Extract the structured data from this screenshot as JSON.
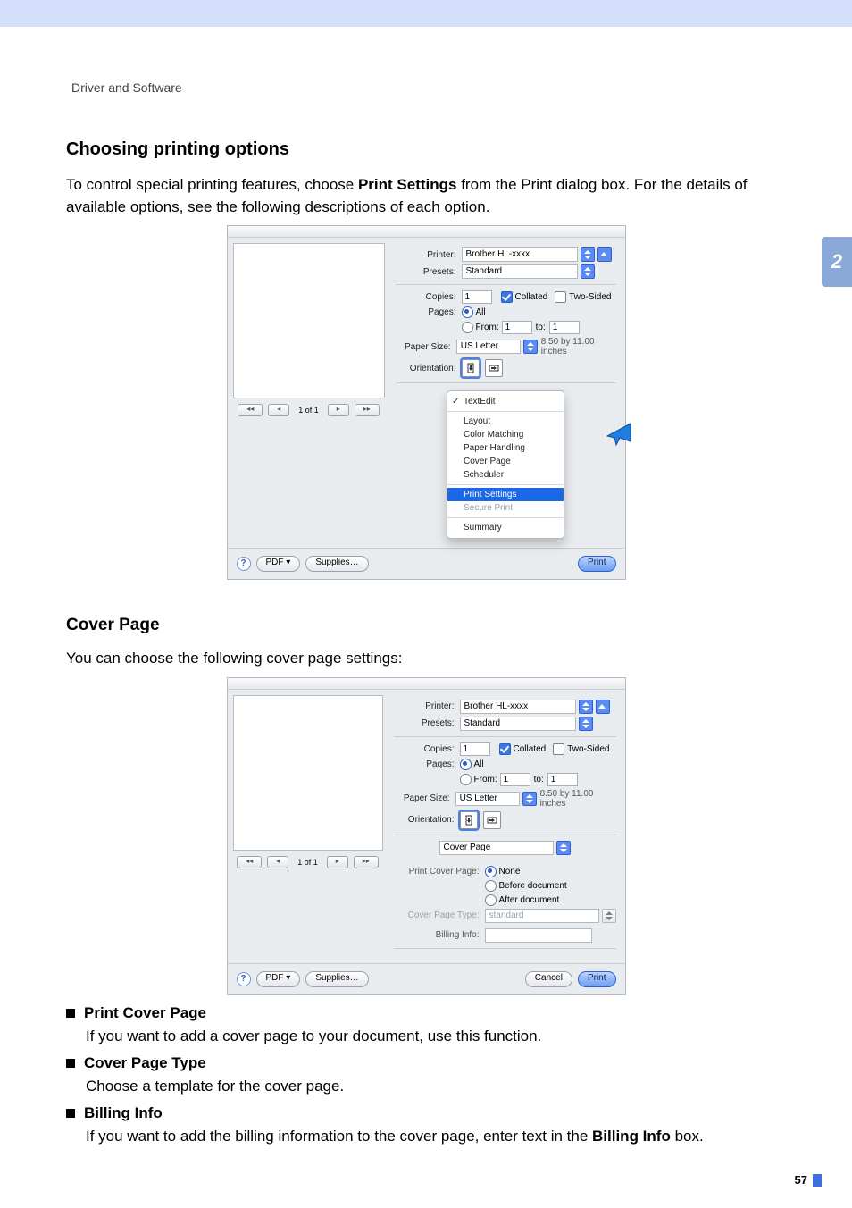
{
  "running_head": "Driver and Software",
  "chapter_tab": "2",
  "page_number": "57",
  "sec1": {
    "h": "Choosing printing options",
    "p_a": "To control special printing features, choose ",
    "p_b": "Print Settings",
    "p_c": " from the Print dialog box. For the details of available options, see the following descriptions of each option."
  },
  "sec2": {
    "h": "Cover Page",
    "p": "You can choose the following cover page settings:"
  },
  "items": {
    "a": {
      "t": "Print Cover Page",
      "d": "If you want to add a cover page to your document, use this function."
    },
    "b": {
      "t": "Cover Page Type",
      "d": "Choose a template for the cover page."
    },
    "c": {
      "t": "Billing Info",
      "d_a": "If you want to add the billing information to the cover page, enter text in the ",
      "d_b": "Billing Info",
      "d_c": " box."
    }
  },
  "dlg": {
    "printer_l": "Printer:",
    "printer_v": "Brother HL-xxxx",
    "presets_l": "Presets:",
    "presets_v": "Standard",
    "copies_l": "Copies:",
    "copies_v": "1",
    "collated": "Collated",
    "twosided": "Two-Sided",
    "pages_l": "Pages:",
    "all": "All",
    "from_l": "From:",
    "from_v": "1",
    "to_l": "to:",
    "to_v": "1",
    "psize_l": "Paper Size:",
    "psize_v": "US Letter",
    "psize_note": "8.50 by 11.00 inches",
    "orient_l": "Orientation:",
    "pager": "1 of 1",
    "help": "?",
    "pdf": "PDF ▾",
    "supplies": "Supplies…",
    "cancel": "Cancel",
    "print": "Print"
  },
  "popup": {
    "textedit": "TextEdit",
    "layout": "Layout",
    "colormatch": "Color Matching",
    "paperhand": "Paper Handling",
    "coverpage": "Cover Page",
    "scheduler": "Scheduler",
    "printsettings": "Print Settings",
    "secure": "Secure Print",
    "summary": "Summary"
  },
  "cov": {
    "section": "Cover Page",
    "pcp_l": "Print Cover Page:",
    "none": "None",
    "before": "Before document",
    "after": "After document",
    "cpt_l": "Cover Page Type:",
    "cpt_v": "standard",
    "bi_l": "Billing Info:"
  }
}
